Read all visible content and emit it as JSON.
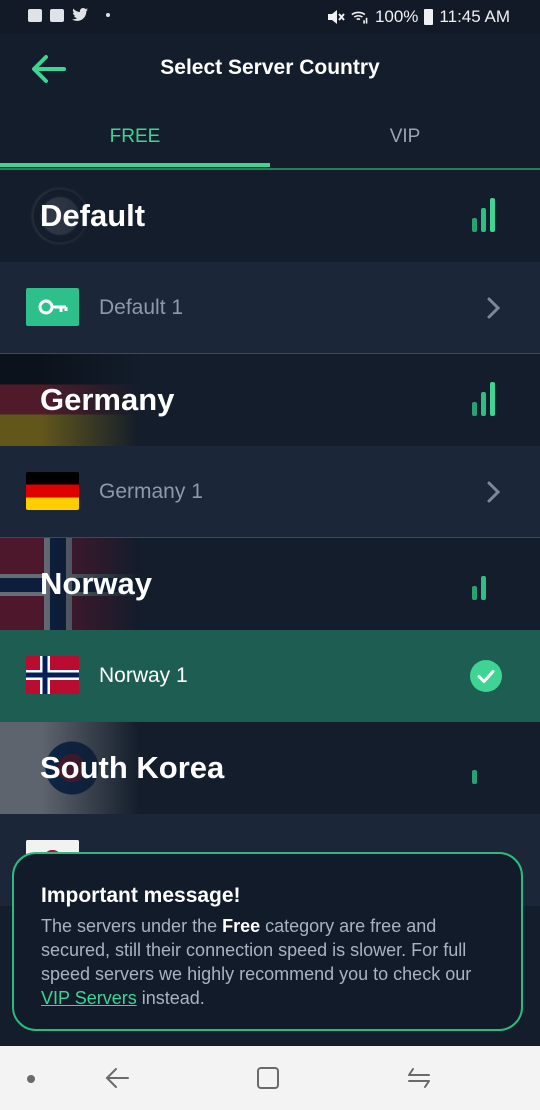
{
  "status_bar": {
    "battery": "100%",
    "time": "11:45 AM",
    "icons": [
      "gallery-icon",
      "news-icon",
      "twitter-icon",
      "mute-icon",
      "wifi-icon",
      "signal-icon",
      "battery-icon"
    ]
  },
  "header": {
    "title": "Select Server Country",
    "back_icon": "arrow-left-icon"
  },
  "tabs": [
    {
      "label": "FREE",
      "active": true
    },
    {
      "label": "VIP",
      "active": false
    }
  ],
  "groups": [
    {
      "title": "Default",
      "signal_level": 3,
      "servers": [
        {
          "label": "Default 1",
          "icon": "key-icon",
          "selected": false
        }
      ]
    },
    {
      "title": "Germany",
      "signal_level": 3,
      "servers": [
        {
          "label": "Germany 1",
          "icon": "germany-flag-icon",
          "selected": false
        }
      ]
    },
    {
      "title": "Norway",
      "signal_level": 2,
      "servers": [
        {
          "label": "Norway 1",
          "icon": "norway-flag-icon",
          "selected": true
        }
      ]
    },
    {
      "title": "South Korea",
      "signal_level": 1,
      "servers": []
    }
  ],
  "message": {
    "title": "Important message!",
    "body_part1": "The servers under the ",
    "body_bold": "Free",
    "body_part2": " category are free and secured, still their connection speed is slower. For full speed servers we highly recommend you to check our ",
    "link_text": "VIP Servers",
    "body_part3": " instead."
  },
  "colors": {
    "accent": "#3fd493",
    "background": "#131d2b",
    "row": "#1c2639",
    "selected_row": "#1e5e52"
  }
}
